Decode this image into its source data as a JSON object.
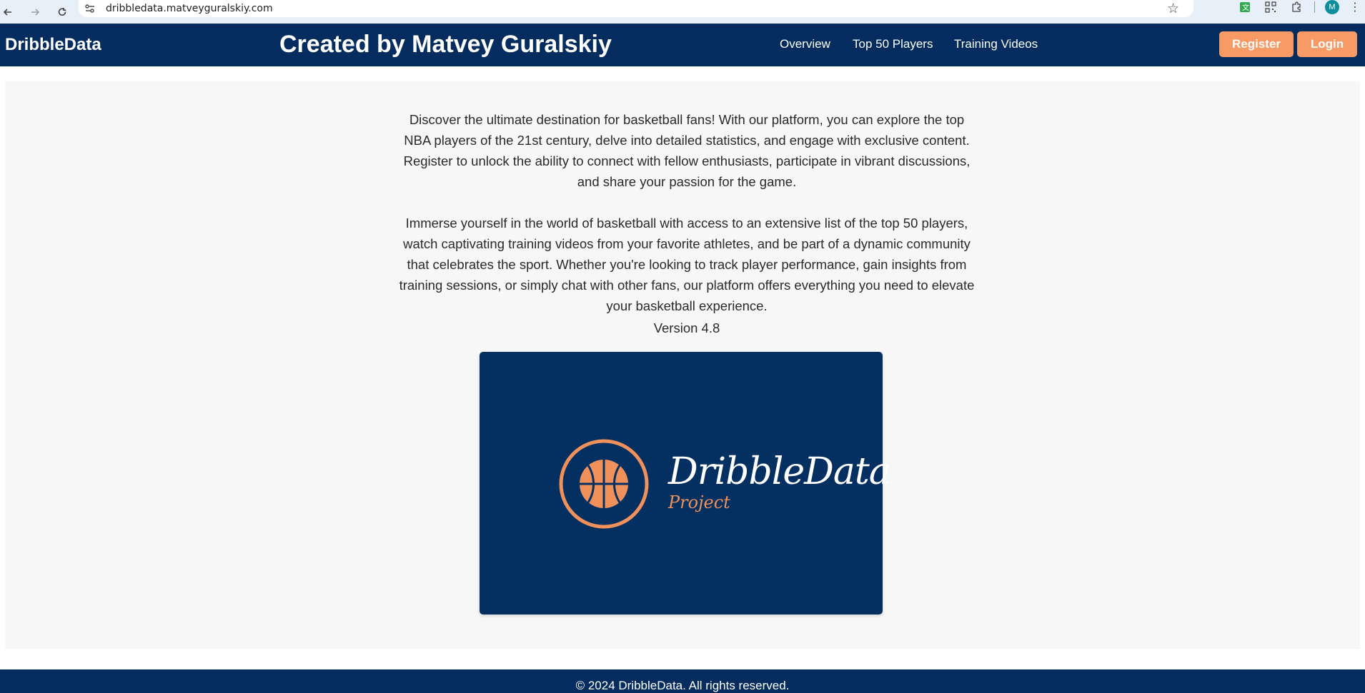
{
  "browser": {
    "url": "dribbledata.matveyguralskiy.com",
    "avatar_letter": "M",
    "icons": [
      "back-icon",
      "forward-icon",
      "reload-icon",
      "site-info-icon",
      "star-icon",
      "translate-icon",
      "qr-icon",
      "extensions-icon",
      "menu-icon"
    ]
  },
  "header": {
    "brand": "DribbleData",
    "creator": "Created by Matvey Guralskiy",
    "nav": [
      "Overview",
      "Top 50 Players",
      "Training Videos"
    ],
    "register_label": "Register",
    "login_label": "Login"
  },
  "main": {
    "para1": "Discover the ultimate destination for basketball fans! With our platform, you can explore the top NBA players of the 21st century, delve into detailed statistics, and engage with exclusive content. Register to unlock the ability to connect with fellow enthusiasts, participate in vibrant discussions, and share your passion for the game.",
    "para2": "Immerse yourself in the world of basketball with access to an extensive list of the top 50 players, watch captivating training videos from your favorite athletes, and be part of a dynamic community that celebrates the sport. Whether you're looking to track player performance, gain insights from training sessions, or simply chat with other fans, our platform offers everything you need to elevate your basketball experience.",
    "version": "Version 4.8",
    "logo": {
      "title": "DribbleData",
      "subtitle": "Project"
    }
  },
  "footer": {
    "copyright": "© 2024 DribbleData. All rights reserved."
  },
  "colors": {
    "navy": "#042c5e",
    "orange": "#f79a66",
    "main_bg": "#f7f7f7"
  }
}
